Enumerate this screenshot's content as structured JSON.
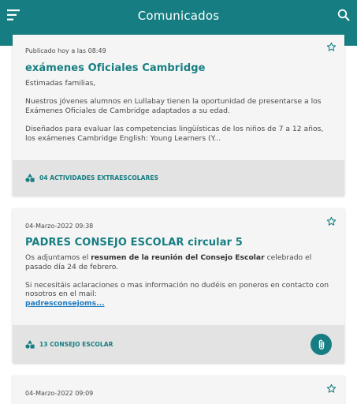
{
  "header": {
    "title": "Comunicados",
    "menu_icon": "hamburger-menu-icon",
    "search_icon": "search-icon",
    "color": "#167e82"
  },
  "posts": [
    {
      "meta": "Publicado hoy a las 08:49",
      "title": "exámenes Oficiales Cambridge",
      "greeting": "Estimadas familias,",
      "paragraph1": "Nuestros jóvenes alumnos en Lullabay tienen la oportunidad de presentarse a los Exámenes Oficiales de Cambridge adaptados a su edad.",
      "paragraph2": "Diseñados para evaluar las competencias lingüísticas de los niños de 7 a 12 años, los exámenes Cambridge English: Young Learners (Y...",
      "category": "04 ACTIVIDADES EXTRAESCOLARES"
    },
    {
      "meta": "04-Marzo-2022 09:38",
      "title": "PADRES CONSEJO ESCOLAR circular 5",
      "text_before_bold": "Os adjuntamos el ",
      "bold_text": "resumen de la reunión del Consejo Escolar",
      "text_after_bold": " celebrado el pasado día 24 de febrero.",
      "paragraph2": "Si necesitáis aclaraciones o mas información no dudéis en poneros en contacto con nosotros en el mail:",
      "link": "padresconsejoms...",
      "category": "13 CONSEJO ESCOLAR",
      "attachment_icon": "paperclip-icon"
    },
    {
      "meta": "04-Marzo-2022 09:09"
    }
  ]
}
